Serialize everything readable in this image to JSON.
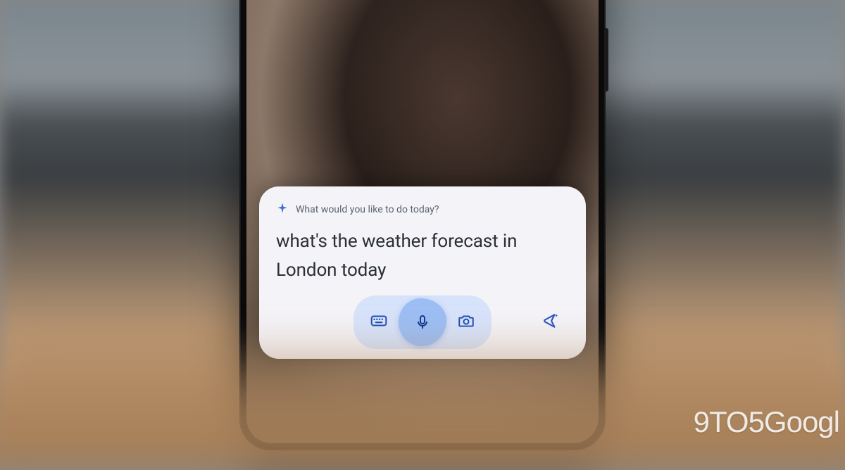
{
  "assistant": {
    "prompt": "What would you like to do today?",
    "transcript": "what's the weather forecast in London today",
    "icons": {
      "sparkle": "sparkle-icon",
      "keyboard": "keyboard-icon",
      "mic": "microphone-icon",
      "camera": "camera-icon",
      "send": "send-icon"
    }
  },
  "watermark": "9TO5Googl",
  "colors": {
    "card_bg": "#f4f3f7",
    "pill_bg": "#d7e3fb",
    "mic_blob": "#9cbef4",
    "accent": "#2a57c9",
    "text_primary": "#2a2f36",
    "text_secondary": "#5a6372"
  }
}
